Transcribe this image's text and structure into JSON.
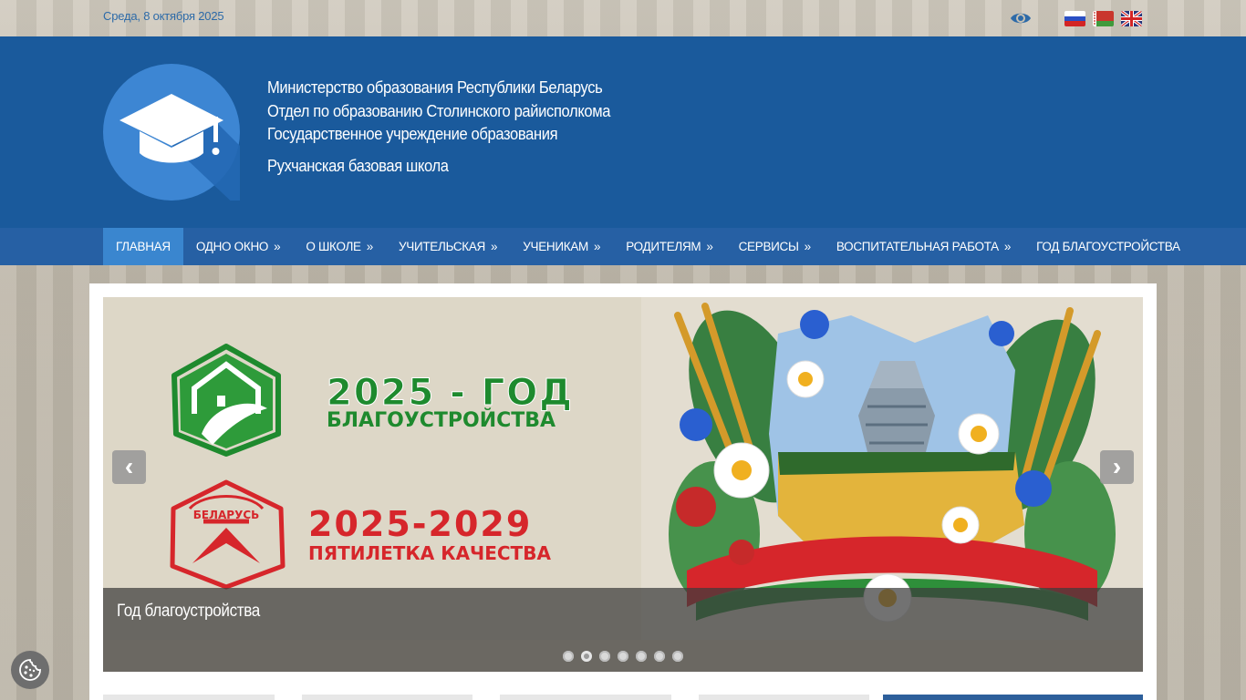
{
  "topbar": {
    "date": "Среда, 8 октября 2025",
    "icons": [
      "eye-icon"
    ],
    "languages": [
      {
        "code": "ru",
        "name": "flag-ru"
      },
      {
        "code": "by",
        "name": "flag-by"
      },
      {
        "code": "en",
        "name": "flag-en"
      }
    ]
  },
  "header": {
    "line1": "Министерство образования Республики Беларусь",
    "line2": "Отдел по образованию Столинского райисполкома",
    "line3": "Государственное учреждение образования",
    "school": "Рухчанская базовая школа"
  },
  "nav": {
    "items": [
      {
        "label": "Главная",
        "arrow": ""
      },
      {
        "label": "Одно окно",
        "arrow": "»"
      },
      {
        "label": "О школе",
        "arrow": "»"
      },
      {
        "label": "Учительская",
        "arrow": "»"
      },
      {
        "label": "Ученикам",
        "arrow": "»"
      },
      {
        "label": "Родителям",
        "arrow": "»"
      },
      {
        "label": "Сервисы",
        "arrow": "»"
      },
      {
        "label": "Воспитательная работа",
        "arrow": "»"
      },
      {
        "label": "Год благоустройства",
        "arrow": ""
      }
    ]
  },
  "slider": {
    "banner1_line1": "2025 - ГОД",
    "banner1_line2": "БЛАГОУСТРОЙСТВА",
    "banner2_line1": "2025-2029",
    "banner2_line2": "ПЯТИЛЕТКА КАЧЕСТВА",
    "badge_text": "БЕЛАРУСЬ",
    "caption": "Год благоустройства",
    "prev": "‹",
    "next": "›",
    "dot_count": 7,
    "active_dot": 2
  },
  "colors": {
    "header_bg": "#1a5a9c",
    "nav_bg": "#2660a4",
    "nav_active": "#3a86cf",
    "green": "#1e8a2e",
    "red": "#d6262b"
  }
}
